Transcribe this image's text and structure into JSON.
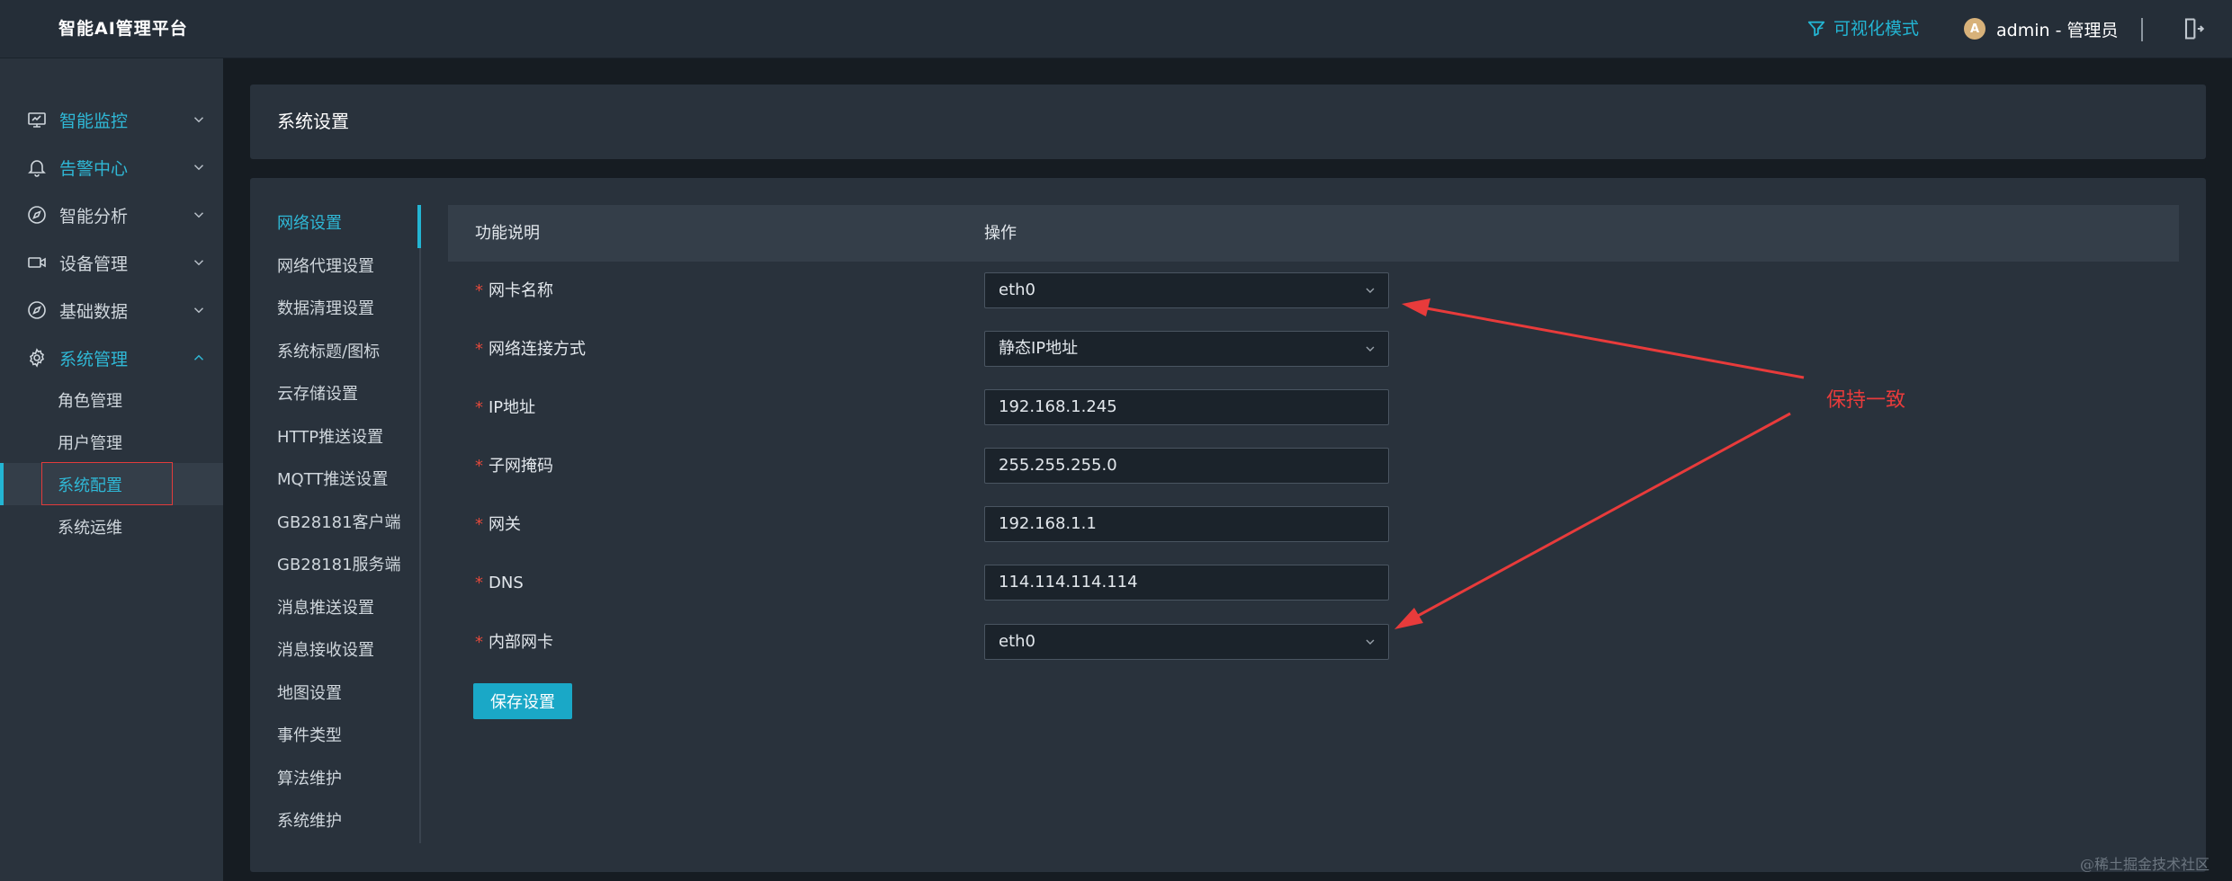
{
  "header": {
    "brand": "智能AI管理平台",
    "viz_mode_label": "可视化模式",
    "avatar_letter": "A",
    "user_label": "admin - 管理员"
  },
  "sidebar": {
    "items": [
      {
        "label": "智能监控",
        "icon": "monitor-icon"
      },
      {
        "label": "告警中心",
        "icon": "bell-icon"
      },
      {
        "label": "智能分析",
        "icon": "compass-icon"
      },
      {
        "label": "设备管理",
        "icon": "camera-icon"
      },
      {
        "label": "基础数据",
        "icon": "compass-icon"
      },
      {
        "label": "系统管理",
        "icon": "gear-icon"
      }
    ],
    "sub_items": [
      "角色管理",
      "用户管理",
      "系统配置",
      "系统运维"
    ]
  },
  "page": {
    "title": "系统设置"
  },
  "settings_nav": [
    "网络设置",
    "网络代理设置",
    "数据清理设置",
    "系统标题/图标",
    "云存储设置",
    "HTTP推送设置",
    "MQTT推送设置",
    "GB28181客户端",
    "GB28181服务端",
    "消息推送设置",
    "消息接收设置",
    "地图设置",
    "事件类型",
    "算法维护",
    "系统维护"
  ],
  "table": {
    "col_description": "功能说明",
    "col_operation": "操作"
  },
  "form": {
    "required_mark": "*",
    "rows": [
      {
        "label": "网卡名称",
        "value": "eth0"
      },
      {
        "label": "网络连接方式",
        "value": "静态IP地址"
      },
      {
        "label": "IP地址",
        "value": "192.168.1.245"
      },
      {
        "label": "子网掩码",
        "value": "255.255.255.0"
      },
      {
        "label": "网关",
        "value": "192.168.1.1"
      },
      {
        "label": "DNS",
        "value": "114.114.114.114"
      },
      {
        "label": "内部网卡",
        "value": "eth0"
      }
    ],
    "save_label": "保存设置"
  },
  "annotation": {
    "text": "保持一致",
    "color": "#e83b3b"
  },
  "watermark": "@稀土掘金技术社区",
  "colors": {
    "accent": "#23b5d3",
    "header_bg": "#252e38",
    "sidebar_bg": "#2a333d",
    "card_bg": "#29323c",
    "required": "#e2493b"
  }
}
